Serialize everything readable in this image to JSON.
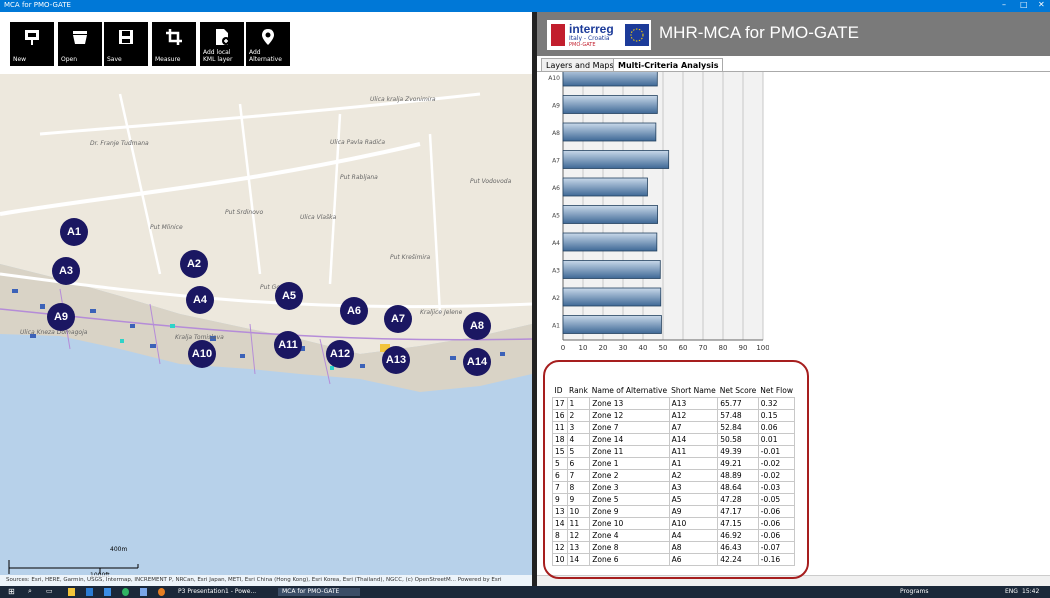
{
  "window": {
    "title": "MCA for PMO-GATE",
    "controls": [
      "–",
      "□",
      "✕"
    ]
  },
  "toolbar": {
    "buttons": [
      {
        "label": "New",
        "icon": "presentation-icon"
      },
      {
        "label": "Open",
        "icon": "open-icon"
      },
      {
        "label": "Save",
        "icon": "save-icon"
      },
      {
        "label": "Measure",
        "icon": "crop-icon"
      },
      {
        "label": "Add local KML layer",
        "icon": "add-file-icon"
      },
      {
        "label": "Add Alternative",
        "icon": "location-pin-icon"
      }
    ]
  },
  "map": {
    "markers": [
      "A1",
      "A2",
      "A3",
      "A4",
      "A5",
      "A6",
      "A7",
      "A8",
      "A9",
      "A10",
      "A11",
      "A12",
      "A13",
      "A14"
    ],
    "streets": [
      "Ulica kralja Zvonimira",
      "Dr. Franje Tuđmana",
      "Ulica Pavla Radića",
      "Put Vodovoda",
      "Put Srdinovo",
      "Put Mlinice",
      "Kralja Tomislava",
      "Ulica Vlaška",
      "Put Krešimira",
      "Ulica Kneza Domagoja",
      "Put Rabljana",
      "Kraljice Jelene",
      "Put Gospe"
    ],
    "scale": {
      "metric": "400m",
      "imperial": "1000ft"
    },
    "attribution": "Sources: Esri, HERE, Garmin, USGS, Intermap, INCREMENT P, NRCan, Esri Japan, METI, Esri China (Hong Kong), Esri Korea, Esri (Thailand), NGCC, (c) OpenStreetM...   Powered by Esri"
  },
  "header": {
    "logo_text": "interreg",
    "logo_sub": "Italy - Croatia",
    "logo_project": "PMO-GATE",
    "title": "MHR-MCA for PMO-GATE"
  },
  "tabs": [
    {
      "label": "Layers and Maps",
      "active": false
    },
    {
      "label": "Multi-Criteria Analysis",
      "active": true
    }
  ],
  "chart_data": {
    "type": "bar",
    "orientation": "horizontal",
    "categories": [
      "A10",
      "A9",
      "A8",
      "A7",
      "A6",
      "A5",
      "A4",
      "A3",
      "A2",
      "A1"
    ],
    "values": [
      47.15,
      47.17,
      46.43,
      52.84,
      42.24,
      47.28,
      46.92,
      48.64,
      48.89,
      49.21
    ],
    "xlim": [
      0,
      100
    ],
    "xticks": [
      "0",
      "10",
      "20",
      "30",
      "40",
      "50",
      "60",
      "70",
      "80",
      "90",
      "100"
    ],
    "grid": true,
    "bar_color": "#3e6896"
  },
  "results_table": {
    "headers": [
      "ID",
      "Rank",
      "Name of Alternative",
      "Short Name",
      "Net Score",
      "Net Flow"
    ],
    "rows": [
      [
        "17",
        "1",
        "Zone 13",
        "A13",
        "65.77",
        "0.32"
      ],
      [
        "16",
        "2",
        "Zone 12",
        "A12",
        "57.48",
        "0.15"
      ],
      [
        "11",
        "3",
        "Zone 7",
        "A7",
        "52.84",
        "0.06"
      ],
      [
        "18",
        "4",
        "Zone 14",
        "A14",
        "50.58",
        "0.01"
      ],
      [
        "15",
        "5",
        "Zone 11",
        "A11",
        "49.39",
        "-0.01"
      ],
      [
        "5",
        "6",
        "Zone 1",
        "A1",
        "49.21",
        "-0.02"
      ],
      [
        "6",
        "7",
        "Zone 2",
        "A2",
        "48.89",
        "-0.02"
      ],
      [
        "7",
        "8",
        "Zone 3",
        "A3",
        "48.64",
        "-0.03"
      ],
      [
        "9",
        "9",
        "Zone 5",
        "A5",
        "47.28",
        "-0.05"
      ],
      [
        "13",
        "10",
        "Zone 9",
        "A9",
        "47.17",
        "-0.06"
      ],
      [
        "14",
        "11",
        "Zone 10",
        "A10",
        "47.15",
        "-0.06"
      ],
      [
        "8",
        "12",
        "Zone 4",
        "A4",
        "46.92",
        "-0.06"
      ],
      [
        "12",
        "13",
        "Zone 8",
        "A8",
        "46.43",
        "-0.07"
      ],
      [
        "10",
        "14",
        "Zone 6",
        "A6",
        "42.24",
        "-0.16"
      ]
    ]
  },
  "taskbar": {
    "apps": [
      "P3 Presentation1 - Powe...",
      "MCA for PMO-GATE"
    ],
    "programs": "Programs",
    "lang": "ENG",
    "time": "15:42"
  }
}
